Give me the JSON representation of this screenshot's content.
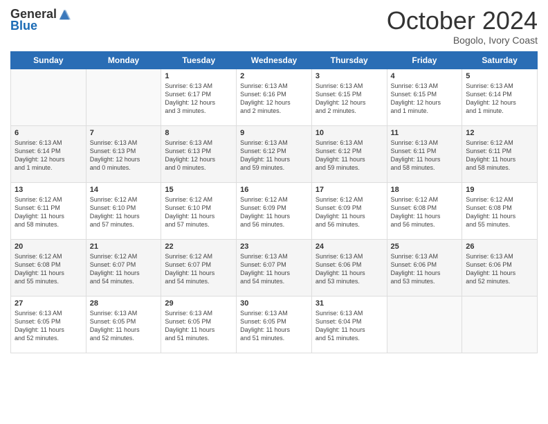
{
  "header": {
    "logo_general": "General",
    "logo_blue": "Blue",
    "month_title": "October 2024",
    "subtitle": "Bogolo, Ivory Coast"
  },
  "days": [
    "Sunday",
    "Monday",
    "Tuesday",
    "Wednesday",
    "Thursday",
    "Friday",
    "Saturday"
  ],
  "weeks": [
    [
      {
        "date": "",
        "info": ""
      },
      {
        "date": "",
        "info": ""
      },
      {
        "date": "1",
        "info": "Sunrise: 6:13 AM\nSunset: 6:17 PM\nDaylight: 12 hours\nand 3 minutes."
      },
      {
        "date": "2",
        "info": "Sunrise: 6:13 AM\nSunset: 6:16 PM\nDaylight: 12 hours\nand 2 minutes."
      },
      {
        "date": "3",
        "info": "Sunrise: 6:13 AM\nSunset: 6:15 PM\nDaylight: 12 hours\nand 2 minutes."
      },
      {
        "date": "4",
        "info": "Sunrise: 6:13 AM\nSunset: 6:15 PM\nDaylight: 12 hours\nand 1 minute."
      },
      {
        "date": "5",
        "info": "Sunrise: 6:13 AM\nSunset: 6:14 PM\nDaylight: 12 hours\nand 1 minute."
      }
    ],
    [
      {
        "date": "6",
        "info": "Sunrise: 6:13 AM\nSunset: 6:14 PM\nDaylight: 12 hours\nand 1 minute."
      },
      {
        "date": "7",
        "info": "Sunrise: 6:13 AM\nSunset: 6:13 PM\nDaylight: 12 hours\nand 0 minutes."
      },
      {
        "date": "8",
        "info": "Sunrise: 6:13 AM\nSunset: 6:13 PM\nDaylight: 12 hours\nand 0 minutes."
      },
      {
        "date": "9",
        "info": "Sunrise: 6:13 AM\nSunset: 6:12 PM\nDaylight: 11 hours\nand 59 minutes."
      },
      {
        "date": "10",
        "info": "Sunrise: 6:13 AM\nSunset: 6:12 PM\nDaylight: 11 hours\nand 59 minutes."
      },
      {
        "date": "11",
        "info": "Sunrise: 6:13 AM\nSunset: 6:11 PM\nDaylight: 11 hours\nand 58 minutes."
      },
      {
        "date": "12",
        "info": "Sunrise: 6:12 AM\nSunset: 6:11 PM\nDaylight: 11 hours\nand 58 minutes."
      }
    ],
    [
      {
        "date": "13",
        "info": "Sunrise: 6:12 AM\nSunset: 6:11 PM\nDaylight: 11 hours\nand 58 minutes."
      },
      {
        "date": "14",
        "info": "Sunrise: 6:12 AM\nSunset: 6:10 PM\nDaylight: 11 hours\nand 57 minutes."
      },
      {
        "date": "15",
        "info": "Sunrise: 6:12 AM\nSunset: 6:10 PM\nDaylight: 11 hours\nand 57 minutes."
      },
      {
        "date": "16",
        "info": "Sunrise: 6:12 AM\nSunset: 6:09 PM\nDaylight: 11 hours\nand 56 minutes."
      },
      {
        "date": "17",
        "info": "Sunrise: 6:12 AM\nSunset: 6:09 PM\nDaylight: 11 hours\nand 56 minutes."
      },
      {
        "date": "18",
        "info": "Sunrise: 6:12 AM\nSunset: 6:08 PM\nDaylight: 11 hours\nand 56 minutes."
      },
      {
        "date": "19",
        "info": "Sunrise: 6:12 AM\nSunset: 6:08 PM\nDaylight: 11 hours\nand 55 minutes."
      }
    ],
    [
      {
        "date": "20",
        "info": "Sunrise: 6:12 AM\nSunset: 6:08 PM\nDaylight: 11 hours\nand 55 minutes."
      },
      {
        "date": "21",
        "info": "Sunrise: 6:12 AM\nSunset: 6:07 PM\nDaylight: 11 hours\nand 54 minutes."
      },
      {
        "date": "22",
        "info": "Sunrise: 6:12 AM\nSunset: 6:07 PM\nDaylight: 11 hours\nand 54 minutes."
      },
      {
        "date": "23",
        "info": "Sunrise: 6:13 AM\nSunset: 6:07 PM\nDaylight: 11 hours\nand 54 minutes."
      },
      {
        "date": "24",
        "info": "Sunrise: 6:13 AM\nSunset: 6:06 PM\nDaylight: 11 hours\nand 53 minutes."
      },
      {
        "date": "25",
        "info": "Sunrise: 6:13 AM\nSunset: 6:06 PM\nDaylight: 11 hours\nand 53 minutes."
      },
      {
        "date": "26",
        "info": "Sunrise: 6:13 AM\nSunset: 6:06 PM\nDaylight: 11 hours\nand 52 minutes."
      }
    ],
    [
      {
        "date": "27",
        "info": "Sunrise: 6:13 AM\nSunset: 6:05 PM\nDaylight: 11 hours\nand 52 minutes."
      },
      {
        "date": "28",
        "info": "Sunrise: 6:13 AM\nSunset: 6:05 PM\nDaylight: 11 hours\nand 52 minutes."
      },
      {
        "date": "29",
        "info": "Sunrise: 6:13 AM\nSunset: 6:05 PM\nDaylight: 11 hours\nand 51 minutes."
      },
      {
        "date": "30",
        "info": "Sunrise: 6:13 AM\nSunset: 6:05 PM\nDaylight: 11 hours\nand 51 minutes."
      },
      {
        "date": "31",
        "info": "Sunrise: 6:13 AM\nSunset: 6:04 PM\nDaylight: 11 hours\nand 51 minutes."
      },
      {
        "date": "",
        "info": ""
      },
      {
        "date": "",
        "info": ""
      }
    ]
  ]
}
